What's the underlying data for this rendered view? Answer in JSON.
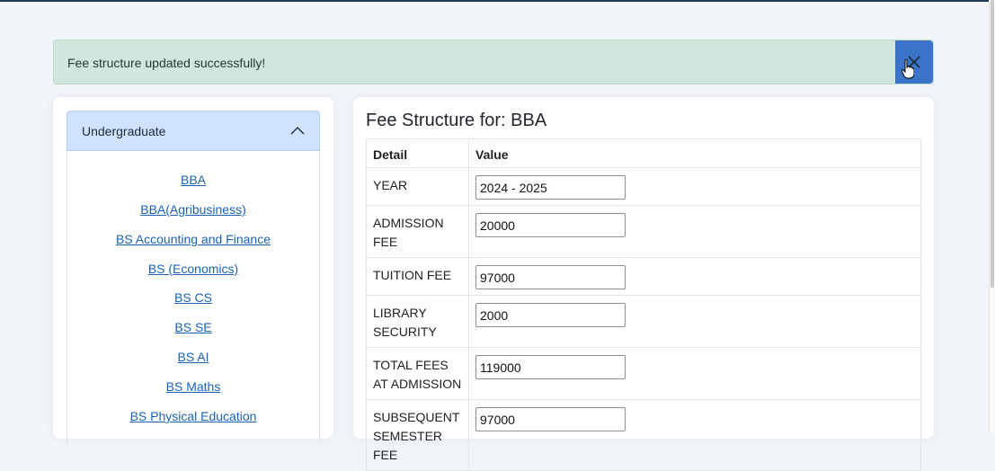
{
  "alert": {
    "message": "Fee structure updated successfully!",
    "close_icon": "close-icon",
    "accent": "#3a73c8",
    "background": "#d1e7dd"
  },
  "sidebar": {
    "accordion_title": "Undergraduate",
    "programs": [
      "BBA",
      "BBA(Agribusiness)",
      "BS Accounting and Finance",
      "BS (Economics)",
      "BS CS",
      "BS SE",
      "BS AI",
      "BS Maths",
      "BS Physical Education"
    ]
  },
  "fee_structure": {
    "title": "Fee Structure for: BBA",
    "columns": [
      "Detail",
      "Value"
    ],
    "rows": [
      {
        "label": "YEAR",
        "value": "2024 - 2025"
      },
      {
        "label": "ADMISSION FEE",
        "value": "20000"
      },
      {
        "label": "TUITION FEE",
        "value": "97000"
      },
      {
        "label": "LIBRARY SECURITY",
        "value": "2000"
      },
      {
        "label": "TOTAL FEES AT ADMISSION",
        "value": "119000"
      },
      {
        "label": "SUBSEQUENT SEMESTER FEE",
        "value": "97000"
      }
    ]
  }
}
